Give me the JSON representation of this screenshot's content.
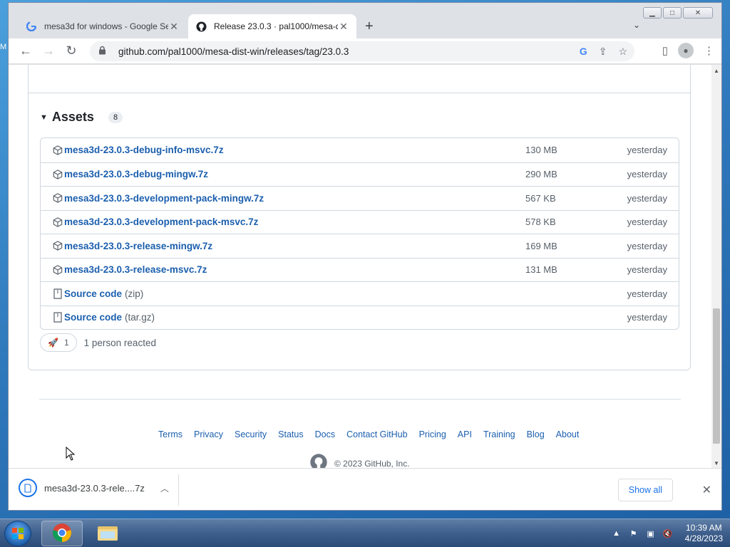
{
  "desktop": {
    "edge_text": "M"
  },
  "browser": {
    "tabs": [
      {
        "title": "mesa3d for windows - Google Se",
        "favicon": "google-icon",
        "active": false
      },
      {
        "title": "Release 23.0.3 · pal1000/mesa-di",
        "favicon": "github-icon",
        "active": true
      }
    ],
    "new_tab_label": "+",
    "url": "github.com/pal1000/mesa-dist-win/releases/tag/23.0.3"
  },
  "page": {
    "assets": {
      "title": "Assets",
      "count": "8",
      "items": [
        {
          "name": "mesa3d-23.0.3-debug-info-msvc.7z",
          "suffix": "",
          "size": "130 MB",
          "date": "yesterday",
          "icon": "package-icon"
        },
        {
          "name": "mesa3d-23.0.3-debug-mingw.7z",
          "suffix": "",
          "size": "290 MB",
          "date": "yesterday",
          "icon": "package-icon"
        },
        {
          "name": "mesa3d-23.0.3-development-pack-mingw.7z",
          "suffix": "",
          "size": "567 KB",
          "date": "yesterday",
          "icon": "package-icon"
        },
        {
          "name": "mesa3d-23.0.3-development-pack-msvc.7z",
          "suffix": "",
          "size": "578 KB",
          "date": "yesterday",
          "icon": "package-icon"
        },
        {
          "name": "mesa3d-23.0.3-release-mingw.7z",
          "suffix": "",
          "size": "169 MB",
          "date": "yesterday",
          "icon": "package-icon"
        },
        {
          "name": "mesa3d-23.0.3-release-msvc.7z",
          "suffix": "",
          "size": "131 MB",
          "date": "yesterday",
          "icon": "package-icon"
        },
        {
          "name": "Source code",
          "suffix": "(zip)",
          "size": "",
          "date": "yesterday",
          "icon": "file-zip-icon"
        },
        {
          "name": "Source code",
          "suffix": "(tar.gz)",
          "size": "",
          "date": "yesterday",
          "icon": "file-zip-icon"
        }
      ]
    },
    "reactions": {
      "emoji": "rocket-icon",
      "count": "1",
      "text": "1 person reacted"
    },
    "footer": {
      "links": [
        "Terms",
        "Privacy",
        "Security",
        "Status",
        "Docs",
        "Contact GitHub",
        "Pricing",
        "API",
        "Training",
        "Blog",
        "About"
      ],
      "copyright": "© 2023 GitHub, Inc."
    }
  },
  "downloads": {
    "file_name": "mesa3d-23.0.3-rele....7z",
    "show_all_label": "Show all"
  },
  "taskbar": {
    "time": "10:39 AM",
    "date": "4/28/2023"
  },
  "colors": {
    "link": "#1b5fae",
    "accent": "#1a73e8",
    "border": "#d0d7de"
  }
}
